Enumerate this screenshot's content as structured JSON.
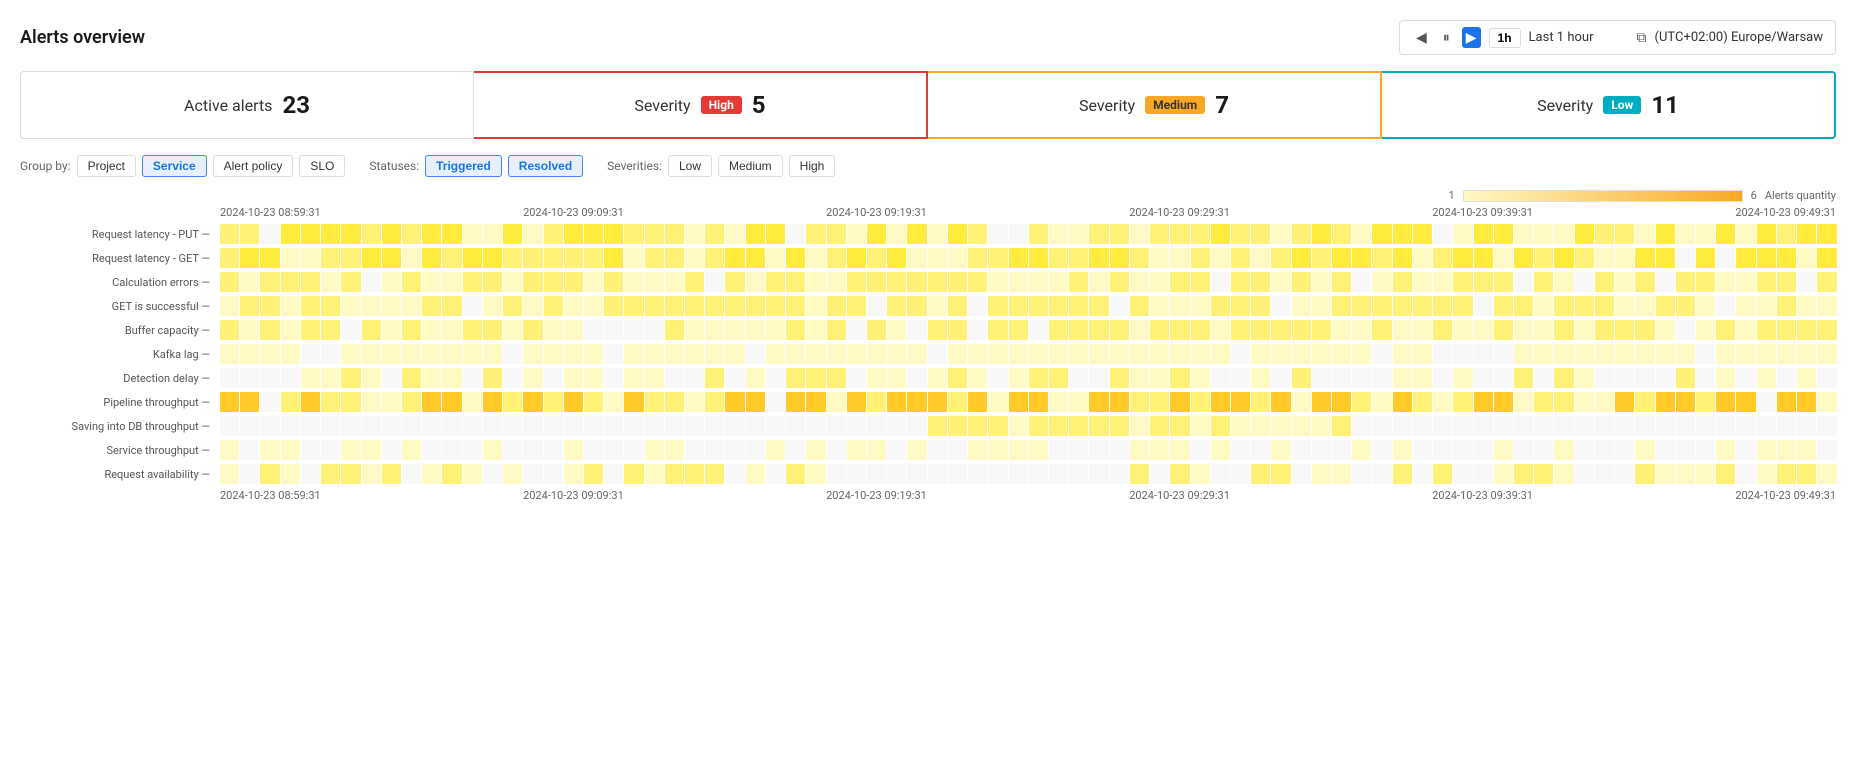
{
  "header": {
    "title": "Alerts overview",
    "controls": {
      "prev_label": "◀",
      "pause_label": "⏸",
      "play_label": "▶",
      "next_label": "▶",
      "time_range": "1h",
      "time_description": "Last 1 hour",
      "copy_icon": "⧉",
      "timezone": "(UTC+02:00) Europe/Warsaw"
    }
  },
  "summary_cards": [
    {
      "label": "Active alerts",
      "value": "23",
      "type": "active"
    },
    {
      "label": "Severity",
      "badge": "High",
      "badge_type": "high",
      "value": "5",
      "type": "high"
    },
    {
      "label": "Severity",
      "badge": "Medium",
      "badge_type": "medium",
      "value": "7",
      "type": "medium"
    },
    {
      "label": "Severity",
      "badge": "Low",
      "badge_type": "low",
      "value": "11",
      "type": "low"
    }
  ],
  "filters": {
    "group_by_label": "Group by:",
    "group_by_options": [
      "Project",
      "Service",
      "Alert policy",
      "SLO"
    ],
    "group_by_active": "Service",
    "statuses_label": "Statuses:",
    "statuses": [
      "Triggered",
      "Resolved"
    ],
    "statuses_active": [
      "Triggered",
      "Resolved"
    ],
    "severities_label": "Severities:",
    "severities": [
      "Low",
      "Medium",
      "High"
    ],
    "severities_active": []
  },
  "legend": {
    "min": "1",
    "max": "6",
    "label": "Alerts quantity"
  },
  "heatmap": {
    "time_labels": [
      "2024-10-23 08:59:31",
      "2024-10-23 09:09:31",
      "2024-10-23 09:19:31",
      "2024-10-23 09:29:31",
      "2024-10-23 09:39:31",
      "2024-10-23 09:49:31"
    ],
    "rows": [
      {
        "label": "Request latency - PUT —",
        "pattern": "mixed-high"
      },
      {
        "label": "Request latency - GET —",
        "pattern": "mixed-high"
      },
      {
        "label": "Calculation errors —",
        "pattern": "mixed-med"
      },
      {
        "label": "GET is successful —",
        "pattern": "mixed-med"
      },
      {
        "label": "Buffer capacity —",
        "pattern": "mixed-med"
      },
      {
        "label": "Kafka lag —",
        "pattern": "mixed-low"
      },
      {
        "label": "Detection delay —",
        "pattern": "sparse"
      },
      {
        "label": "Pipeline throughput —",
        "pattern": "mixed-orange"
      },
      {
        "label": "Saving into DB throughput —",
        "pattern": "partial"
      },
      {
        "label": "Service throughput —",
        "pattern": "sparse-low"
      },
      {
        "label": "Request availability —",
        "pattern": "mixed-sparse"
      }
    ]
  }
}
